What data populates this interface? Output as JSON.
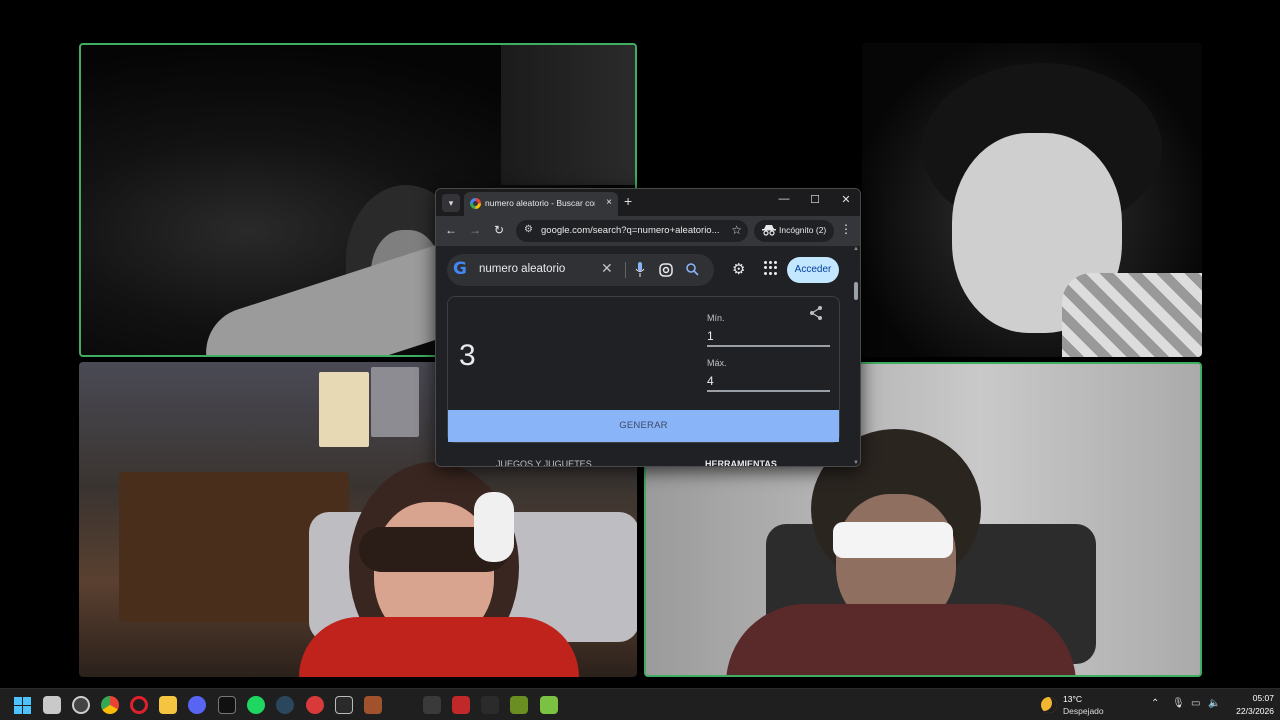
{
  "browser": {
    "tab_title": "numero aleatorio - Buscar con Google",
    "tab_close_icon": "×",
    "new_tab_icon": "+",
    "window_controls": {
      "minimize": "—",
      "maximize": "☐",
      "close": "✕"
    },
    "url": "google.com/search?q=numero+aleatorio...",
    "incognito_label": "Incógnito (2)"
  },
  "search": {
    "query": "numero aleatorio",
    "signin_label": "Acceder"
  },
  "rng": {
    "result": "3",
    "min_label": "Mín.",
    "min_value": "1",
    "max_label": "Máx.",
    "max_value": "4",
    "generate_label": "GENERAR"
  },
  "categories": [
    "JUEGOS Y JUGUETES",
    "HERRAMIENTAS"
  ],
  "taskbar": {
    "weather_temp": "13°C",
    "weather_condition": "Despejado",
    "time": "05:07",
    "date": "22/3/2026",
    "icons": [
      "start-icon",
      "file-explorer-icon",
      "obs-icon",
      "chrome-icon",
      "opera-gx-icon",
      "files-icon",
      "discord-icon",
      "epic-like-icon",
      "spotify-icon",
      "steam-icon",
      "chat-app-icon",
      "epic-games-icon",
      "winrar-icon",
      "app-icon",
      "app-icon-2",
      "app-icon-3",
      "minecraft-icon",
      "game-icon"
    ]
  },
  "colors": {
    "active_speaker_border": "#3fae62",
    "generate_button": "#8ab4f8",
    "signin_button": "#c2e7ff"
  }
}
